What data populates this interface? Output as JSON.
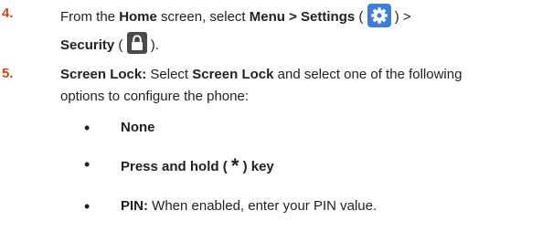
{
  "steps": [
    {
      "number": "4.",
      "line1": {
        "t1": "From the ",
        "b1": "Home",
        "t2": " screen, select ",
        "b2": "Menu > Settings",
        "t3": " ( ",
        "icon": "settings-gear-icon",
        "t4": " ) >"
      },
      "line2": {
        "b1": "Security",
        "t1": " ( ",
        "icon": "lock-icon",
        "t2": " )."
      }
    },
    {
      "number": "5.",
      "line1": {
        "b1": "Screen Lock:",
        "t1": " Select ",
        "b2": "Screen Lock",
        "t2": " and select one of the following"
      },
      "line2": "options to configure the phone:",
      "options": [
        {
          "bullet": "•",
          "b1": "None"
        },
        {
          "bullet": "•",
          "b1": "Press and hold ( ",
          "star": "*",
          "b2": " ) key"
        },
        {
          "bullet": "•",
          "b1": "PIN:",
          "t1": " When enabled, enter your PIN value."
        }
      ]
    }
  ],
  "colors": {
    "step_number": "#d5480f",
    "settings_icon_bg": "#3d7fd6",
    "lock_icon_bg": "#4a4a4a"
  }
}
